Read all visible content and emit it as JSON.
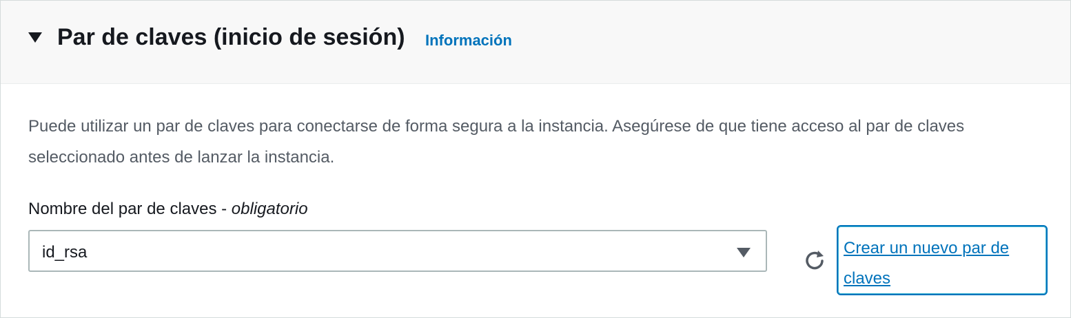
{
  "section": {
    "title": "Par de claves (inicio de sesión)",
    "info_link": "Información",
    "description": "Puede utilizar un par de claves para conectarse de forma segura a la instancia. Asegúrese de que tiene acceso al par de claves seleccionado antes de lanzar la instancia.",
    "field": {
      "label": "Nombre del par de claves - ",
      "required_label": "obligatorio",
      "selected_value": "id_rsa"
    },
    "create_link": "Crear un nuevo par de claves"
  },
  "icons": {
    "collapse": "caret-down-icon",
    "dropdown": "dropdown-caret-icon",
    "refresh": "refresh-icon"
  },
  "colors": {
    "link": "#0073bb",
    "header_bg": "#f8f8f8",
    "text": "#16191f",
    "secondary_text": "#545b64"
  }
}
